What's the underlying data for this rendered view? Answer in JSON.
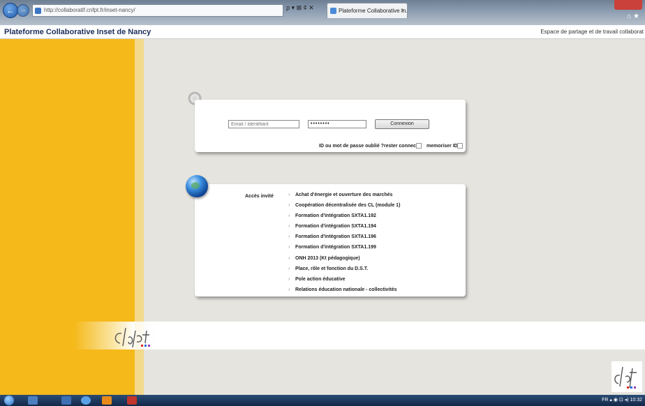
{
  "browser": {
    "address": "http://collaboratif.cnfpt.fr/inset-nancy/",
    "address_tools": "ρ ▾ ⊠ ¢ ✕",
    "tab_title": "Plateforme Collaborative In...",
    "tab_close": "×",
    "nav_back": "←",
    "nav_forward": "→",
    "chrome_icons": "⌂ ★"
  },
  "header": {
    "title": "Plateforme Collaborative Inset de Nancy",
    "subtitle": "Espace de partage et de travail collaborat"
  },
  "login": {
    "email_placeholder": "Email / Identifiant",
    "password_value": "••••••••",
    "connect_label": "Connexion",
    "forgot_label": "ID ou mot de passe oublié ?",
    "stay_connected_label": "rester connecté",
    "remember_id_label": "memoriser ID"
  },
  "guest": {
    "label": "Accès invité",
    "items": [
      "Achat d'énergie et ouverture des marchés",
      "Coopération décentralisée des CL (module 1)",
      "Formation d'intégration SXTA1.192",
      "Formation d'intégration SXTA1.194",
      "Formation d'intégration SXTA1.196",
      "Formation d'intégration SXTA1.199",
      "ONH 2013 (Kt pédagogique)",
      "Place, rôle et fonction du D.S.T.",
      "Pole action éducative",
      "Relations éducation nationale - collectivités"
    ]
  },
  "logo": {
    "text": "cnfpt"
  },
  "taskbar": {
    "tray": "FR  ▴  ◉  ⊡  ◂)  10:32"
  },
  "colors": {
    "yellow": "#f5b91a",
    "light_yellow": "#f3d98c",
    "content_bg": "#e6e4df"
  },
  "icons": [
    "back-icon",
    "forward-icon",
    "key-icon",
    "globe-icon",
    "checkbox-icon",
    "chevron-right-icon"
  ]
}
